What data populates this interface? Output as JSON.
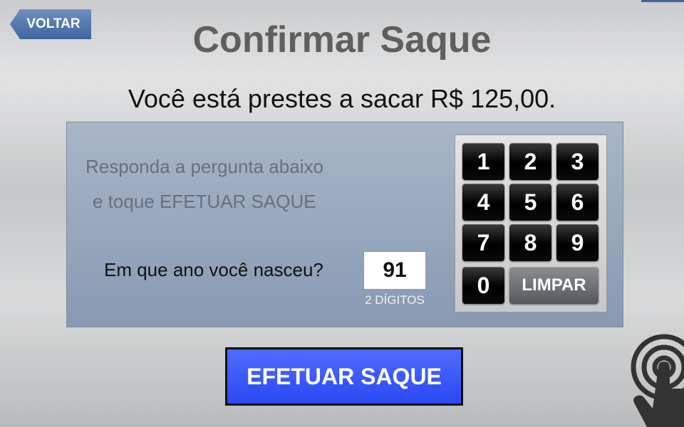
{
  "header": {
    "back_label": "VOLTAR",
    "title": "Confirmar Saque"
  },
  "message": "Você está prestes a sacar R$ 125,00.",
  "instructions": {
    "line1": "Responda a pergunta abaixo",
    "line2": "e toque EFETUAR SAQUE"
  },
  "question": {
    "label": "Em que ano você nasceu?",
    "value": "91",
    "hint": "2 DÍGITOS"
  },
  "keypad": {
    "keys": [
      "1",
      "2",
      "3",
      "4",
      "5",
      "6",
      "7",
      "8",
      "9",
      "0"
    ],
    "clear_label": "LIMPAR"
  },
  "submit_label": "EFETUAR SAQUE",
  "colors": {
    "back_button": "#3f65a0",
    "submit_button": "#2b48f4",
    "panel": "#8799b2",
    "key": "#000000"
  },
  "icons": {
    "touch": "touch-hand-icon"
  }
}
